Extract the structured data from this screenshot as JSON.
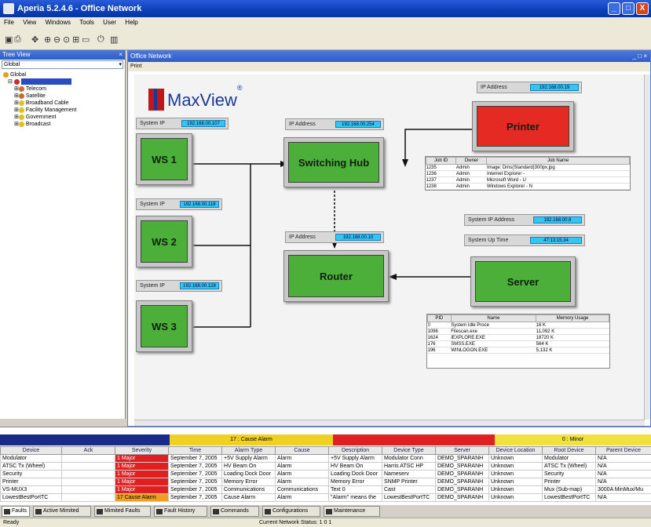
{
  "window": {
    "title": "Aperia 5.2.4.6 - Office Network",
    "min": "_",
    "max": "□",
    "close": "X"
  },
  "menu": [
    "File",
    "View",
    "Windows",
    "Tools",
    "User",
    "Help"
  ],
  "toolbar_icons": [
    "save-icon",
    "print-icon",
    "pin-icon",
    "zoom-in-icon",
    "zoom-out-icon",
    "zoom-fit-icon",
    "grid-icon",
    "screen-icon",
    "power-icon",
    "chart-icon"
  ],
  "tree": {
    "title": "Tree View",
    "combo": "Global",
    "items": [
      {
        "label": "Global",
        "color": "#e0a020"
      },
      {
        "label": "",
        "color": "#c03030",
        "selected": true
      },
      {
        "label": "Telecom",
        "color": "#c07030"
      },
      {
        "label": "Satellite",
        "color": "#c07030"
      },
      {
        "label": "Broadband Cable",
        "color": "#e0c020"
      },
      {
        "label": "Facility Management",
        "color": "#e0c020"
      },
      {
        "label": "Government",
        "color": "#e0c020"
      },
      {
        "label": "Broadcast",
        "color": "#e0c020"
      }
    ]
  },
  "diagram": {
    "title": "Office Network",
    "menu": "Print",
    "logo_text": "MaxView",
    "logo_mark": "®",
    "nodes": {
      "ws1": {
        "label": "WS 1",
        "ip_label": "System IP",
        "ip": "192.168.00.107"
      },
      "ws2": {
        "label": "WS 2",
        "ip_label": "System IP",
        "ip": "192.168.00.118"
      },
      "ws3": {
        "label": "WS 3",
        "ip_label": "System IP",
        "ip": "192.168.00.128"
      },
      "hub": {
        "label": "Switching Hub",
        "ip_label": "IP Address",
        "ip": "192.168.00.254"
      },
      "router": {
        "label": "Router",
        "ip_label": "IP Address",
        "ip": "192.168.00.10"
      },
      "printer": {
        "label": "Printer",
        "ip_label": "IP Address",
        "ip": "192.168.00.19"
      },
      "server": {
        "label": "Server",
        "ip_label": "System IP Address",
        "ip": "192.168.00.6",
        "uptime_label": "System Up Time",
        "uptime": "47:13:15.34"
      }
    },
    "print_jobs": {
      "headers": [
        "Job ID",
        "Owner",
        "Job Name"
      ],
      "rows": [
        [
          "1235",
          "Admin",
          "Image: Dms(Standard)300px.jpg"
        ],
        [
          "1236",
          "Admin",
          "Internet Explorer -"
        ],
        [
          "1237",
          "Admin",
          "Microsoft Word - U"
        ],
        [
          "1238",
          "Admin",
          "Windows Explorer - N"
        ]
      ]
    },
    "processes": {
      "headers": [
        "PID",
        "Name",
        "Memory Usage"
      ],
      "rows": [
        [
          "0",
          "System Idle Proce",
          "16 K"
        ],
        [
          "1096",
          "Filescan.exe",
          "11,092 K"
        ],
        [
          "1624",
          "IEXPLORE.EXE",
          "18720 K"
        ],
        [
          "176",
          "SMSS.EXE",
          "564 K"
        ],
        [
          "196",
          "WINLOGON.EXE",
          "5,132 K"
        ]
      ]
    }
  },
  "alarms": {
    "severity_bars": [
      {
        "label": "",
        "color": "#1a2a88"
      },
      {
        "label": "17 : Cause Alarm",
        "color": "#f0d020"
      },
      {
        "label": "",
        "color": "#e02020"
      },
      {
        "label": "0 : Minor",
        "color": "#f0e040"
      }
    ],
    "columns": [
      "Device",
      "Ack",
      "Severity",
      "Time",
      "Alarm Type",
      "Cause",
      "Description",
      "Device Type",
      "Server",
      "Device Location",
      "Root Device",
      "Parent Device"
    ],
    "rows": [
      [
        "Modulator",
        "",
        "1 Major",
        "September 7, 2005",
        "+5V Supply Alarm",
        "Alarm",
        "+5V Supply Alarm",
        "Modulator Conn",
        "DEMO_SPARANH",
        "Unknown",
        "Modulator",
        "N/A"
      ],
      [
        "ATSC Tx (Wheel)",
        "",
        "1 Major",
        "September 7, 2005",
        "HV Beam On",
        "Alarm",
        "HV Beam On",
        "Harris ATSC HP",
        "DEMO_SPARANH",
        "Unknown",
        "ATSC Tx (Wheel)",
        "N/A"
      ],
      [
        "Security",
        "",
        "1 Major",
        "September 7, 2005",
        "Loading Dock Door",
        "Alarm",
        "Loading Dock Door",
        "Nameserv",
        "DEMO_SPARANH",
        "Unknown",
        "Security",
        "N/A"
      ],
      [
        "Printer",
        "",
        "1 Major",
        "September 7, 2005",
        "Memory Error",
        "Alarm",
        "Memory Error",
        "SNMP Printer",
        "DEMO_SPARANH",
        "Unknown",
        "Printer",
        "N/A"
      ],
      [
        "VS-MUX3",
        "",
        "1 Major",
        "September 7, 2005",
        "Communications",
        "Communications",
        "Text 0",
        "Cast",
        "DEMO_SPARANH",
        "Unknown",
        "Mux (Sub-map)",
        "3000A MinMux/Mu"
      ],
      [
        "LowestBestPortTC",
        "",
        "17 Cause Alarm",
        "September 7, 2005",
        "Cause Alarm",
        "Alarm",
        "\"Alarm\" means the",
        "LowestBestPortTC",
        "DEMO_SPARANH",
        "Unknown",
        "LowestBestPortTC",
        "N/A"
      ]
    ]
  },
  "tabs": [
    "Faults",
    "Active Mimited",
    "Mimited Faults",
    "Fault History",
    "Commands",
    "Configurations",
    "Maintenance"
  ],
  "status": "Ready",
  "status_center": "Current Network Status: 1 0 1"
}
